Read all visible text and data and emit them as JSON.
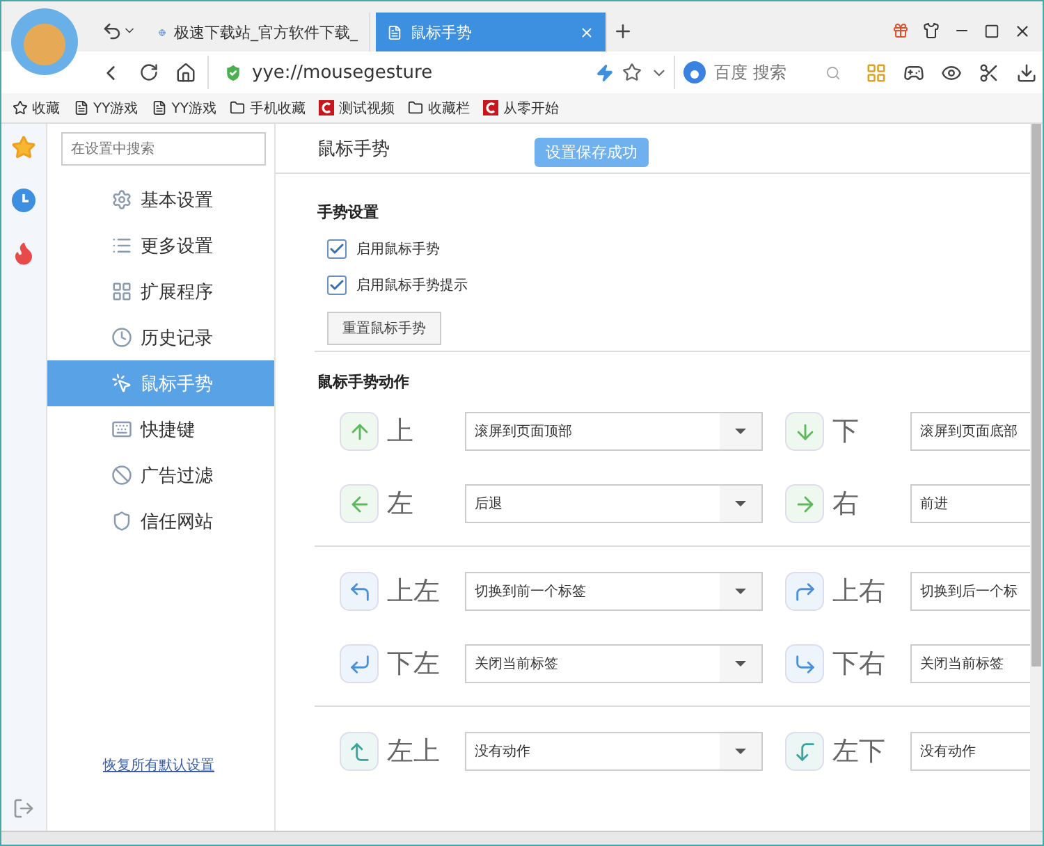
{
  "browser": {
    "tabs": [
      {
        "title": "极速下载站_官方软件下载_",
        "kind": "globe",
        "selected": false
      },
      {
        "title": "鼠标手势",
        "kind": "page",
        "selected": true
      }
    ],
    "address": "yye://mousegesture",
    "search": {
      "placeholder": "百度 搜索"
    },
    "bookmarks": [
      {
        "label": "收藏",
        "kind": "star"
      },
      {
        "label": "YY游戏",
        "kind": "page"
      },
      {
        "label": "YY游戏",
        "kind": "page"
      },
      {
        "label": "手机收藏",
        "kind": "folder"
      },
      {
        "label": "测试视频",
        "kind": "logo"
      },
      {
        "label": "收藏栏",
        "kind": "folder"
      },
      {
        "label": "从零开始",
        "kind": "logo"
      }
    ]
  },
  "settings": {
    "search": {
      "placeholder": "在设置中搜索"
    },
    "nav": [
      {
        "label": "基本设置",
        "kind": "gear",
        "selected": false
      },
      {
        "label": "更多设置",
        "kind": "list",
        "selected": false
      },
      {
        "label": "扩展程序",
        "kind": "grid",
        "selected": false
      },
      {
        "label": "历史记录",
        "kind": "clock",
        "selected": false
      },
      {
        "label": "鼠标手势",
        "kind": "pointer",
        "selected": true
      },
      {
        "label": "快捷键",
        "kind": "keyboard",
        "selected": false
      },
      {
        "label": "广告过滤",
        "kind": "ban",
        "selected": false
      },
      {
        "label": "信任网站",
        "kind": "shield",
        "selected": false
      }
    ],
    "restore_link": "恢复所有默认设置"
  },
  "page": {
    "title": "鼠标手势",
    "toast": "设置保存成功",
    "gesture_settings": {
      "heading": "手势设置",
      "options": [
        {
          "label": "启用鼠标手势",
          "checked": true
        },
        {
          "label": "启用鼠标手势提示",
          "checked": true
        }
      ],
      "reset_button": "重置鼠标手势"
    },
    "actions": {
      "heading": "鼠标手势动作",
      "groups": [
        [
          {
            "kind": "up",
            "label": "上",
            "action": "滚屏到页面顶部",
            "color": "#5cb85c"
          },
          {
            "kind": "down",
            "label": "下",
            "action": "滚屏到页面底部",
            "color": "#5cb85c"
          },
          {
            "kind": "left",
            "label": "左",
            "action": "后退",
            "color": "#5cb85c"
          },
          {
            "kind": "right",
            "label": "右",
            "action": "前进",
            "color": "#5cb85c"
          }
        ],
        [
          {
            "kind": "upleft",
            "label": "上左",
            "action": "切换到前一个标签",
            "color": "#4a90d9"
          },
          {
            "kind": "upright",
            "label": "上右",
            "action": "切换到后一个标",
            "color": "#4a90d9"
          },
          {
            "kind": "downleft",
            "label": "下左",
            "action": "关闭当前标签",
            "color": "#4a90d9"
          },
          {
            "kind": "downright",
            "label": "下右",
            "action": "关闭当前标签",
            "color": "#4a90d9"
          }
        ],
        [
          {
            "kind": "leftup",
            "label": "左上",
            "action": "没有动作",
            "color": "#3aa39a"
          },
          {
            "kind": "leftdown",
            "label": "左下",
            "action": "没有动作",
            "color": "#3aa39a"
          }
        ]
      ]
    }
  }
}
